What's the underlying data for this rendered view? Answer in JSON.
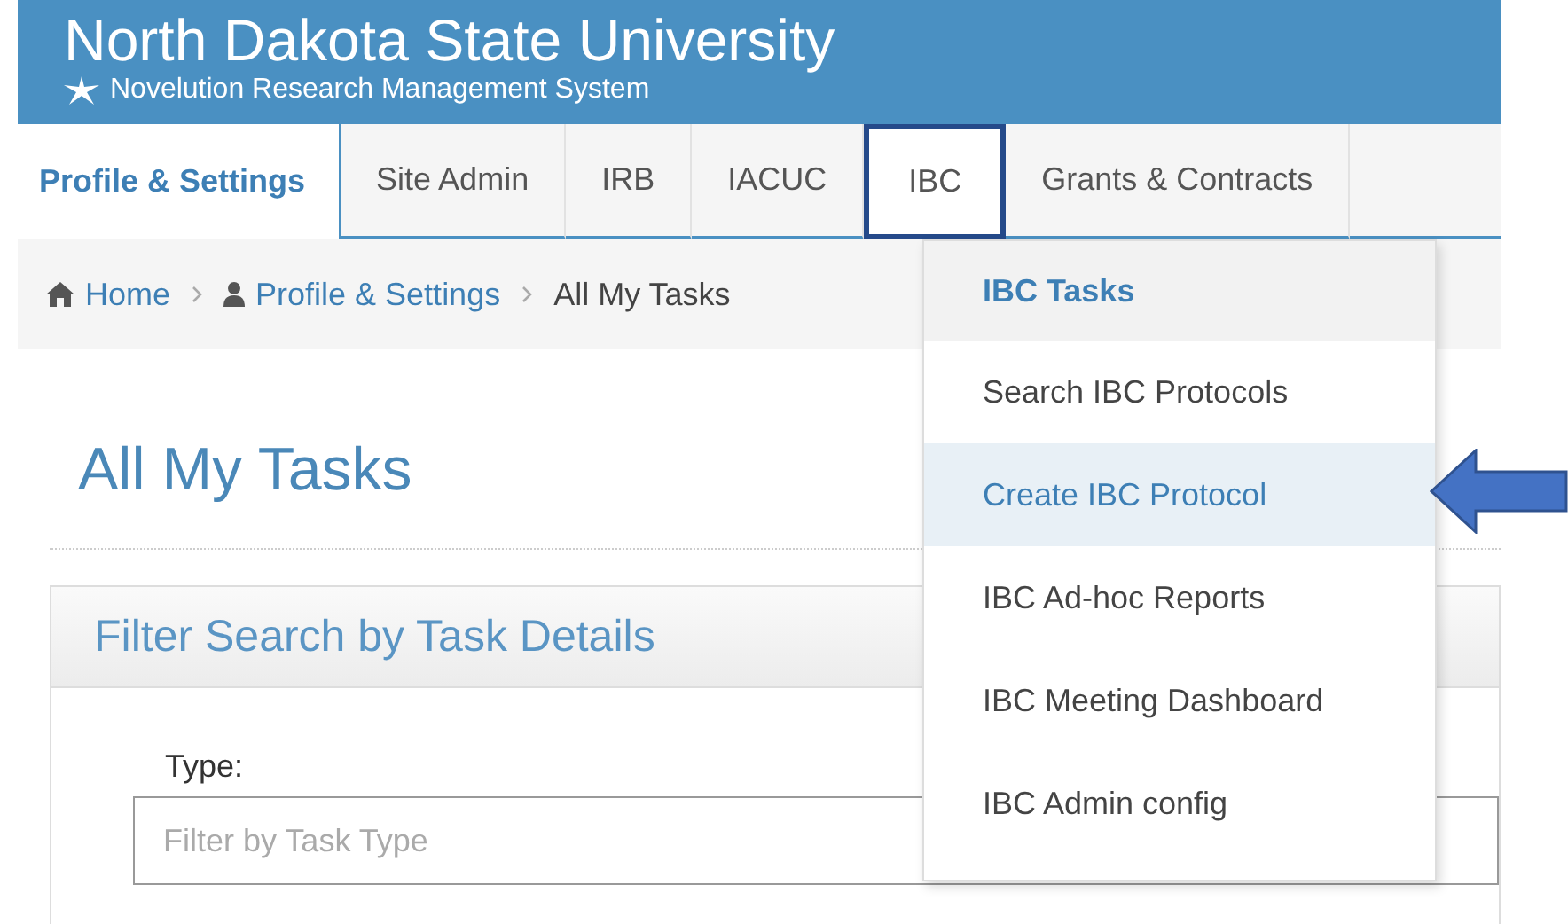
{
  "header": {
    "title": "North Dakota State University",
    "subtitle": "Novelution Research Management System"
  },
  "tabs": [
    {
      "label": "Profile & Settings",
      "selected": true,
      "open": false
    },
    {
      "label": "Site Admin",
      "selected": false,
      "open": false
    },
    {
      "label": "IRB",
      "selected": false,
      "open": false
    },
    {
      "label": "IACUC",
      "selected": false,
      "open": false
    },
    {
      "label": "IBC",
      "selected": false,
      "open": true
    },
    {
      "label": "Grants & Contracts",
      "selected": false,
      "open": false
    }
  ],
  "breadcrumb": [
    {
      "label": "Home",
      "kind": "home"
    },
    {
      "label": "Profile & Settings",
      "kind": "user"
    },
    {
      "label": "All My Tasks",
      "kind": "current"
    }
  ],
  "page_title": "All My Tasks",
  "panel": {
    "title": "Filter Search by Task Details",
    "field_label": "Type:",
    "placeholder": "Filter by Task Type"
  },
  "menu": {
    "title": "IBC Tasks",
    "items": [
      {
        "label": "Search IBC Protocols",
        "selected": false
      },
      {
        "label": "Create IBC Protocol",
        "selected": true
      },
      {
        "label": "IBC Ad-hoc Reports",
        "selected": false
      },
      {
        "label": "IBC Meeting Dashboard",
        "selected": false
      },
      {
        "label": "IBC Admin config",
        "selected": false
      }
    ]
  }
}
